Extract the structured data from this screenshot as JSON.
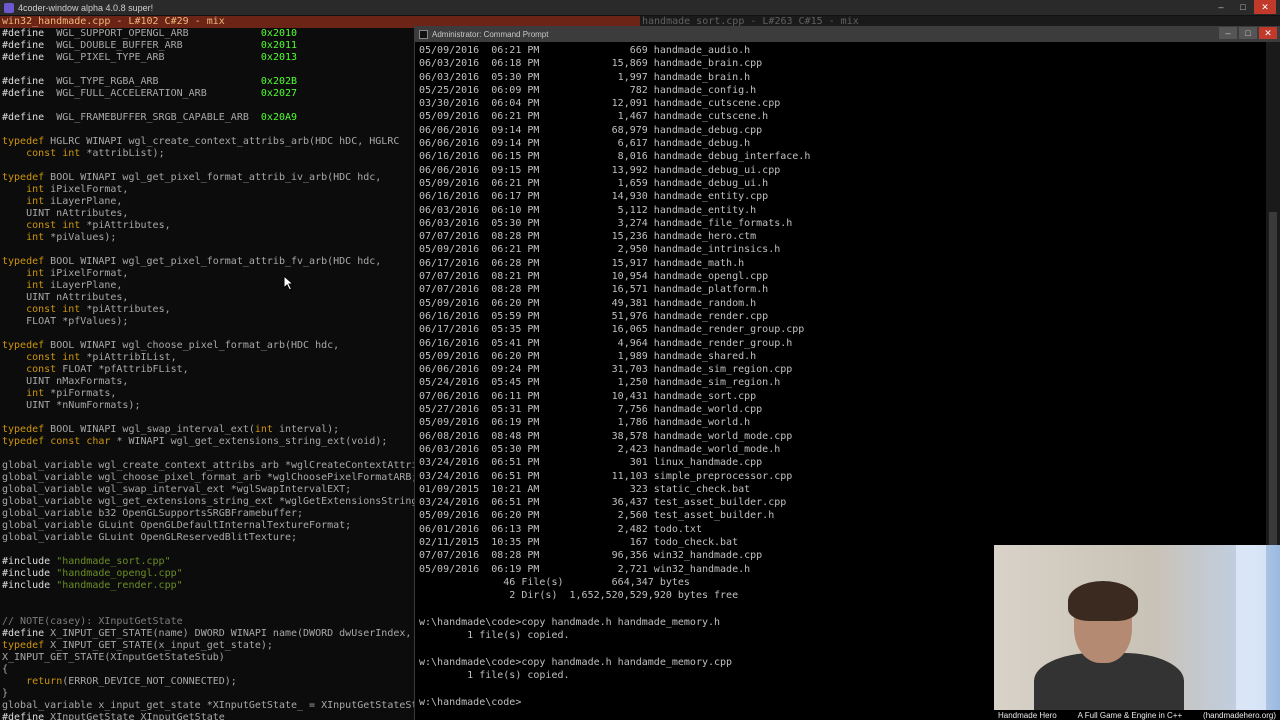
{
  "editor": {
    "window_title": "4coder-window alpha 4.0.8 super!",
    "left_file_bar": "win32_handmade.cpp - L#102 C#29 - mix",
    "right_file_bar": "handmade_sort.cpp - L#263 C#15 - mix",
    "code_lines": [
      [
        [
          "pp",
          "#define"
        ],
        [
          "",
          "  WGL_SUPPORT_OPENGL_ARB            "
        ],
        [
          "num",
          "0x2010"
        ]
      ],
      [
        [
          "pp",
          "#define"
        ],
        [
          "",
          "  WGL_DOUBLE_BUFFER_ARB             "
        ],
        [
          "num",
          "0x2011"
        ]
      ],
      [
        [
          "pp",
          "#define"
        ],
        [
          "",
          "  WGL_PIXEL_TYPE_ARB                "
        ],
        [
          "num",
          "0x2013"
        ]
      ],
      [],
      [
        [
          "pp",
          "#define"
        ],
        [
          "",
          "  WGL_TYPE_RGBA_ARB                 "
        ],
        [
          "num",
          "0x202B"
        ]
      ],
      [
        [
          "pp",
          "#define"
        ],
        [
          "",
          "  WGL_FULL_ACCELERATION_ARB         "
        ],
        [
          "num",
          "0x2027"
        ]
      ],
      [],
      [
        [
          "pp",
          "#define"
        ],
        [
          "",
          "  WGL_FRAMEBUFFER_SRGB_CAPABLE_ARB  "
        ],
        [
          "num",
          "0x20A9"
        ]
      ],
      [],
      [
        [
          "kw",
          "typedef"
        ],
        [
          "",
          " HGLRC WINAPI wgl_create_context_attribs_arb(HDC hDC, HGLRC"
        ]
      ],
      [
        [
          "",
          "    "
        ],
        [
          "kw",
          "const"
        ],
        [
          "",
          " "
        ],
        [
          "kw",
          "int"
        ],
        [
          "",
          " *attribList);"
        ]
      ],
      [],
      [
        [
          "kw",
          "typedef"
        ],
        [
          "",
          " BOOL WINAPI wgl_get_pixel_format_attrib_iv_arb(HDC hdc,"
        ]
      ],
      [
        [
          "",
          "    "
        ],
        [
          "kw",
          "int"
        ],
        [
          "",
          " iPixelFormat,"
        ]
      ],
      [
        [
          "",
          "    "
        ],
        [
          "kw",
          "int"
        ],
        [
          "",
          " iLayerPlane,"
        ]
      ],
      [
        [
          "",
          "    UINT nAttributes,"
        ]
      ],
      [
        [
          "",
          "    "
        ],
        [
          "kw",
          "const"
        ],
        [
          "",
          " "
        ],
        [
          "kw",
          "int"
        ],
        [
          "",
          " *piAttributes,"
        ]
      ],
      [
        [
          "",
          "    "
        ],
        [
          "kw",
          "int"
        ],
        [
          "",
          " *piValues);"
        ]
      ],
      [],
      [
        [
          "kw",
          "typedef"
        ],
        [
          "",
          " BOOL WINAPI wgl_get_pixel_format_attrib_fv_arb(HDC hdc,"
        ]
      ],
      [
        [
          "",
          "    "
        ],
        [
          "kw",
          "int"
        ],
        [
          "",
          " iPixelFormat,"
        ]
      ],
      [
        [
          "",
          "    "
        ],
        [
          "kw",
          "int"
        ],
        [
          "",
          " iLayerPlane,"
        ]
      ],
      [
        [
          "",
          "    UINT nAttributes,"
        ]
      ],
      [
        [
          "",
          "    "
        ],
        [
          "kw",
          "const"
        ],
        [
          "",
          " "
        ],
        [
          "kw",
          "int"
        ],
        [
          "",
          " *piAttributes,"
        ]
      ],
      [
        [
          "",
          "    FLOAT *pfValues);"
        ]
      ],
      [],
      [
        [
          "kw",
          "typedef"
        ],
        [
          "",
          " BOOL WINAPI wgl_choose_pixel_format_arb(HDC hdc,"
        ]
      ],
      [
        [
          "",
          "    "
        ],
        [
          "kw",
          "const"
        ],
        [
          "",
          " "
        ],
        [
          "kw",
          "int"
        ],
        [
          "",
          " *piAttribIList,"
        ]
      ],
      [
        [
          "",
          "    "
        ],
        [
          "kw",
          "const"
        ],
        [
          "",
          " FLOAT *pfAttribFList,"
        ]
      ],
      [
        [
          "",
          "    UINT nMaxFormats,"
        ]
      ],
      [
        [
          "",
          "    "
        ],
        [
          "kw",
          "int"
        ],
        [
          "",
          " *piFormats,"
        ]
      ],
      [
        [
          "",
          "    UINT *nNumFormats);"
        ]
      ],
      [],
      [
        [
          "kw",
          "typedef"
        ],
        [
          "",
          " BOOL WINAPI wgl_swap_interval_ext("
        ],
        [
          "kw",
          "int"
        ],
        [
          "",
          " interval);"
        ]
      ],
      [
        [
          "kw",
          "typedef"
        ],
        [
          "",
          " "
        ],
        [
          "kw",
          "const"
        ],
        [
          "",
          " "
        ],
        [
          "kw",
          "char"
        ],
        [
          "",
          " * WINAPI wgl_get_extensions_string_ext(void);"
        ]
      ],
      [],
      [
        [
          "",
          "global_variable wgl_create_context_attribs_arb *wglCreateContextAttribsARB;"
        ]
      ],
      [
        [
          "",
          "global_variable wgl_choose_pixel_format_arb *wglChoosePixelFormatARB;"
        ]
      ],
      [
        [
          "",
          "global_variable wgl_swap_interval_ext *wglSwapIntervalEXT;"
        ]
      ],
      [
        [
          "",
          "global_variable wgl_get_extensions_string_ext *wglGetExtensionsStringEXT;"
        ]
      ],
      [
        [
          "",
          "global_variable b32 OpenGLSupportsSRGBFramebuffer;"
        ]
      ],
      [
        [
          "",
          "global_variable GLuint OpenGLDefaultInternalTextureFormat;"
        ]
      ],
      [
        [
          "",
          "global_variable GLuint OpenGLReservedBlitTexture;"
        ]
      ],
      [],
      [
        [
          "pp",
          "#include"
        ],
        [
          "",
          " "
        ],
        [
          "str",
          "\"handmade_sort.cpp\""
        ]
      ],
      [
        [
          "pp",
          "#include"
        ],
        [
          "",
          " "
        ],
        [
          "str",
          "\"handmade_opengl.cpp\""
        ]
      ],
      [
        [
          "pp",
          "#include"
        ],
        [
          "",
          " "
        ],
        [
          "str",
          "\"handmade_render.cpp\""
        ]
      ],
      [],
      [],
      [
        [
          "cm",
          "// NOTE(casey): XInputGetState"
        ]
      ],
      [
        [
          "pp",
          "#define"
        ],
        [
          "",
          " X_INPUT_GET_STATE(name) DWORD WINAPI name(DWORD dwUserIndex,"
        ]
      ],
      [
        [
          "kw",
          "typedef"
        ],
        [
          "",
          " X_INPUT_GET_STATE(x_input_get_state);"
        ]
      ],
      [
        [
          "",
          "X_INPUT_GET_STATE(XInputGetStateStub)"
        ]
      ],
      [
        [
          "",
          "{"
        ]
      ],
      [
        [
          "",
          "    "
        ],
        [
          "kw",
          "return"
        ],
        [
          "",
          "(ERROR_DEVICE_NOT_CONNECTED);"
        ]
      ],
      [
        [
          "",
          "}"
        ]
      ],
      [
        [
          "",
          "global_variable x_input_get_state *XInputGetState_ = XInputGetStateStub;"
        ]
      ],
      [
        [
          "pp",
          "#define"
        ],
        [
          "",
          " XInputGetState XInputGetState_"
        ]
      ]
    ]
  },
  "cmd": {
    "window_title": "Administrator: Command Prompt",
    "lines": [
      "05/09/2016  06:21 PM               669 handmade_audio.h",
      "06/03/2016  06:18 PM            15,869 handmade_brain.cpp",
      "06/03/2016  05:30 PM             1,997 handmade_brain.h",
      "05/25/2016  06:09 PM               782 handmade_config.h",
      "03/30/2016  06:04 PM            12,091 handmade_cutscene.cpp",
      "05/09/2016  06:21 PM             1,467 handmade_cutscene.h",
      "06/06/2016  09:14 PM            68,979 handmade_debug.cpp",
      "06/06/2016  09:14 PM             6,617 handmade_debug.h",
      "06/16/2016  06:15 PM             8,016 handmade_debug_interface.h",
      "06/06/2016  09:15 PM            13,992 handmade_debug_ui.cpp",
      "05/09/2016  06:21 PM             1,659 handmade_debug_ui.h",
      "06/16/2016  06:17 PM            14,930 handmade_entity.cpp",
      "06/03/2016  06:10 PM             5,112 handmade_entity.h",
      "06/03/2016  05:30 PM             3,274 handmade_file_formats.h",
      "07/07/2016  08:28 PM            15,236 handmade_hero.ctm",
      "05/09/2016  06:21 PM             2,950 handmade_intrinsics.h",
      "06/17/2016  06:28 PM            15,917 handmade_math.h",
      "07/07/2016  08:21 PM            10,954 handmade_opengl.cpp",
      "07/07/2016  08:28 PM            16,571 handmade_platform.h",
      "05/09/2016  06:20 PM            49,381 handmade_random.h",
      "06/16/2016  05:59 PM            51,976 handmade_render.cpp",
      "06/17/2016  05:35 PM            16,065 handmade_render_group.cpp",
      "06/16/2016  05:41 PM             4,964 handmade_render_group.h",
      "05/09/2016  06:20 PM             1,989 handmade_shared.h",
      "06/06/2016  09:24 PM            31,703 handmade_sim_region.cpp",
      "05/24/2016  05:45 PM             1,250 handmade_sim_region.h",
      "07/06/2016  06:11 PM            10,431 handmade_sort.cpp",
      "05/27/2016  05:31 PM             7,756 handmade_world.cpp",
      "05/09/2016  06:19 PM             1,786 handmade_world.h",
      "06/08/2016  08:48 PM            38,578 handmade_world_mode.cpp",
      "06/03/2016  05:30 PM             2,423 handmade_world_mode.h",
      "03/24/2016  06:51 PM               301 linux_handmade.cpp",
      "03/24/2016  06:51 PM            11,103 simple_preprocessor.cpp",
      "01/09/2015  10:21 AM               323 static_check.bat",
      "03/24/2016  06:51 PM            36,437 test_asset_builder.cpp",
      "05/09/2016  06:20 PM             2,560 test_asset_builder.h",
      "06/01/2016  06:13 PM             2,482 todo.txt",
      "02/11/2015  10:35 PM               167 todo_check.bat",
      "07/07/2016  08:28 PM            96,356 win32_handmade.cpp",
      "05/09/2016  06:19 PM             2,721 win32_handmade.h",
      "              46 File(s)        664,347 bytes",
      "               2 Dir(s)  1,652,520,529,920 bytes free",
      "",
      "w:\\handmade\\code>copy handmade.h handmade_memory.h",
      "        1 file(s) copied.",
      "",
      "w:\\handmade\\code>copy handmade.h handamde_memory.cpp",
      "        1 file(s) copied.",
      "",
      "w:\\handmade\\code>"
    ]
  },
  "caption": {
    "left": "Handmade Hero",
    "middle": "A Full Game & Engine in C++",
    "right": "(handmadehero.org)"
  },
  "icons": {
    "editor_app": "app-icon",
    "cmd_app": "console-icon",
    "mouse": "mouse-cursor-icon"
  },
  "colors": {
    "file_bar": "#6b2416",
    "preprocessor": "#dcdcdc",
    "keyword": "#cd950c",
    "number": "#50ff30",
    "string": "#6b8e23",
    "comment": "#7d7d7d"
  }
}
